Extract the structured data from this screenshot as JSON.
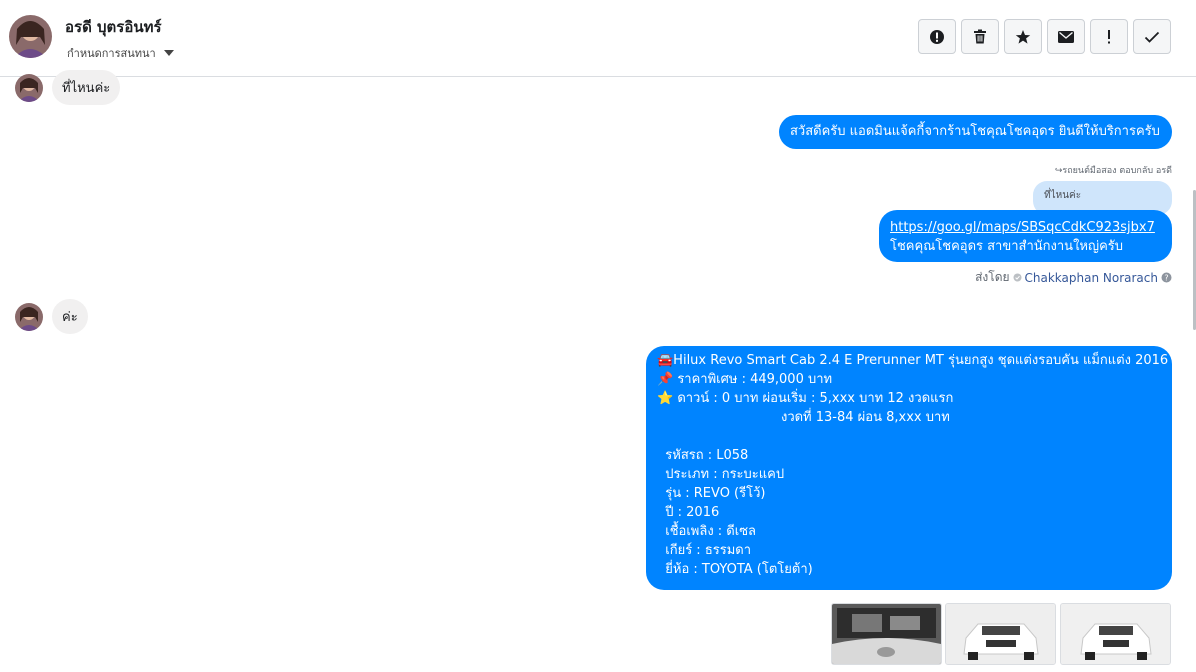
{
  "header": {
    "contact_name": "อรดี บุตรอินทร์",
    "subtitle": "กำหนดการสนทนา",
    "actions": [
      {
        "name": "alert-circle-icon"
      },
      {
        "name": "trash-icon"
      },
      {
        "name": "star-icon"
      },
      {
        "name": "mail-icon"
      },
      {
        "name": "exclamation-icon"
      },
      {
        "name": "check-icon"
      }
    ]
  },
  "messages": {
    "m1_in": "ที่ไหนค่ะ",
    "m2_out": "สวัสดีครับ แอดมินแจ้คกี้จากร้านโชคุณโชคอุดร ยินดีให้บริการครับ",
    "reply_meta": "↪รถยนต์มือสอง ตอบกลับ อรดี",
    "quoted": "ที่ไหนค่ะ",
    "link": "https://goo.gl/maps/SBSqcCdkC923sjbx7",
    "link_caption": "โชคคุณโชคอุดร สาขาสำนักงานใหญ่ครับ",
    "sent_by_label": "ส่งโดย",
    "sent_by_name": "Chakkaphan Norarach",
    "m3_in": "ค่ะ",
    "listing_lines": [
      "🚘Hilux Revo Smart Cab 2.4 E Prerunner MT รุ่นยกสูง ชุดแต่งรอบคัน แม็กแต่ง 2016",
      "📌 ราคาพิเศษ : 449,000 บาท",
      "⭐ ดาวน์ : 0 บาท ผ่อนเริ่ม : 5,xxx บาท 12 งวดแรก",
      "                              งวดที่ 13-84 ผ่อน 8,xxx บาท",
      "",
      "  รหัสรถ : L058",
      "  ประเภท : กระบะแคป",
      "  รุ่น : REVO (รีโว้)",
      "  ปี : 2016",
      "  เชื้อเพลิง : ดีเซล",
      "  เกียร์ : ธรรมดา",
      "  ยี่ห้อ : TOYOTA (โตโยต้า)"
    ]
  },
  "colors": {
    "outgoing": "#0084ff",
    "incoming": "#f1f0f0",
    "quoted": "#cfe5fb",
    "link_name": "#365899"
  }
}
